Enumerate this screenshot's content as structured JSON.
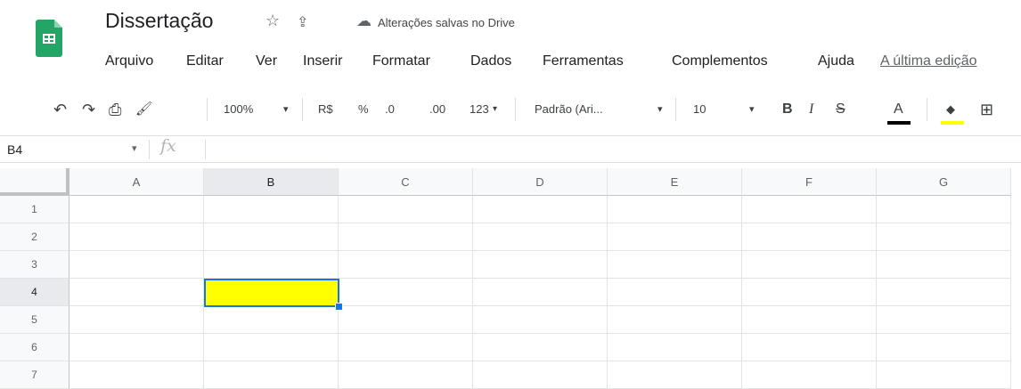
{
  "header": {
    "title": "Dissertação",
    "save_status": "Alterações salvas no Drive",
    "star_icon": "☆",
    "move_icon": "⇪",
    "cloud_icon": "☁",
    "last_edit": "A última edição"
  },
  "menu": [
    "Arquivo",
    "Editar",
    "Ver",
    "Inserir",
    "Formatar",
    "Dados",
    "Ferramentas",
    "Complementos",
    "Ajuda"
  ],
  "toolbar": {
    "undo": "↶",
    "redo": "↷",
    "print": "⎙",
    "paint_format": "🖌",
    "zoom": "100%",
    "currency": "R$",
    "percent": "%",
    "decrease_decimal": ".0",
    "increase_decimal": ".00",
    "more_formats": "123",
    "font": "Padrão (Ari...",
    "font_size": "10",
    "bold": "B",
    "italic": "I",
    "strikethrough": "S",
    "text_color": "A",
    "fill_color": "◆",
    "borders": "⊞",
    "dropdown": "▾",
    "text_color_value": "#000000",
    "fill_color_value": "#ffff00"
  },
  "formula_bar": {
    "name_box": "B4",
    "arrow": "▾",
    "fx": "fx",
    "value": ""
  },
  "grid": {
    "columns": [
      "A",
      "B",
      "C",
      "D",
      "E",
      "F",
      "G"
    ],
    "rows": [
      "1",
      "2",
      "3",
      "4",
      "5",
      "6",
      "7"
    ],
    "selected_cell": "B4",
    "selected_cell_fill": "#ffff00"
  }
}
